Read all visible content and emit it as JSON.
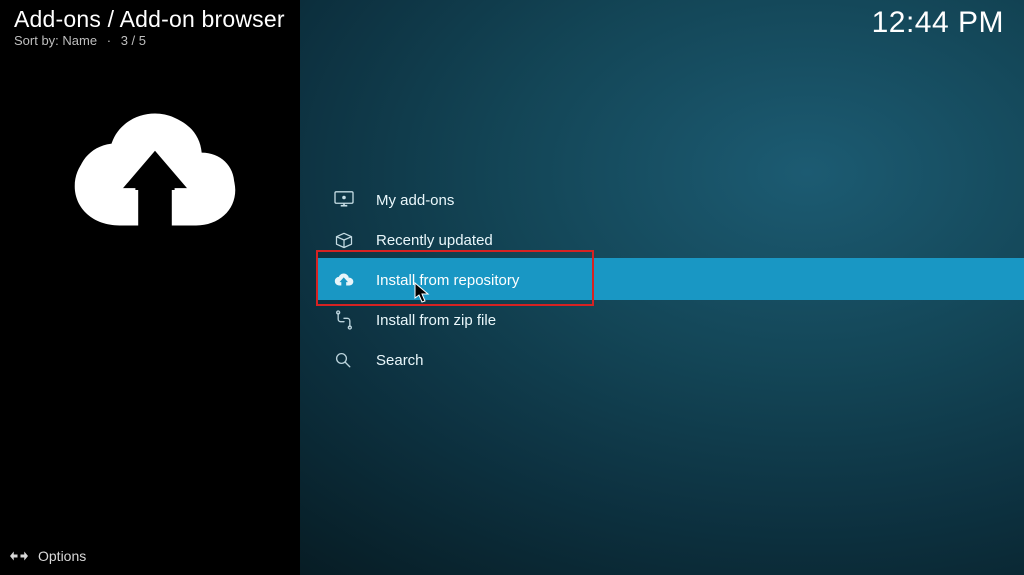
{
  "header": {
    "breadcrumb": "Add-ons / Add-on browser",
    "sort_label": "Sort by:",
    "sort_value": "Name",
    "position": "3 / 5"
  },
  "clock": "12:44 PM",
  "menu": {
    "items": [
      {
        "icon": "screen-icon",
        "label": "My add-ons"
      },
      {
        "icon": "box-open-icon",
        "label": "Recently updated"
      },
      {
        "icon": "cloud-download-icon",
        "label": "Install from repository",
        "selected": true
      },
      {
        "icon": "pipes-icon",
        "label": "Install from zip file"
      },
      {
        "icon": "search-icon",
        "label": "Search"
      }
    ]
  },
  "footer": {
    "options_label": "Options"
  }
}
